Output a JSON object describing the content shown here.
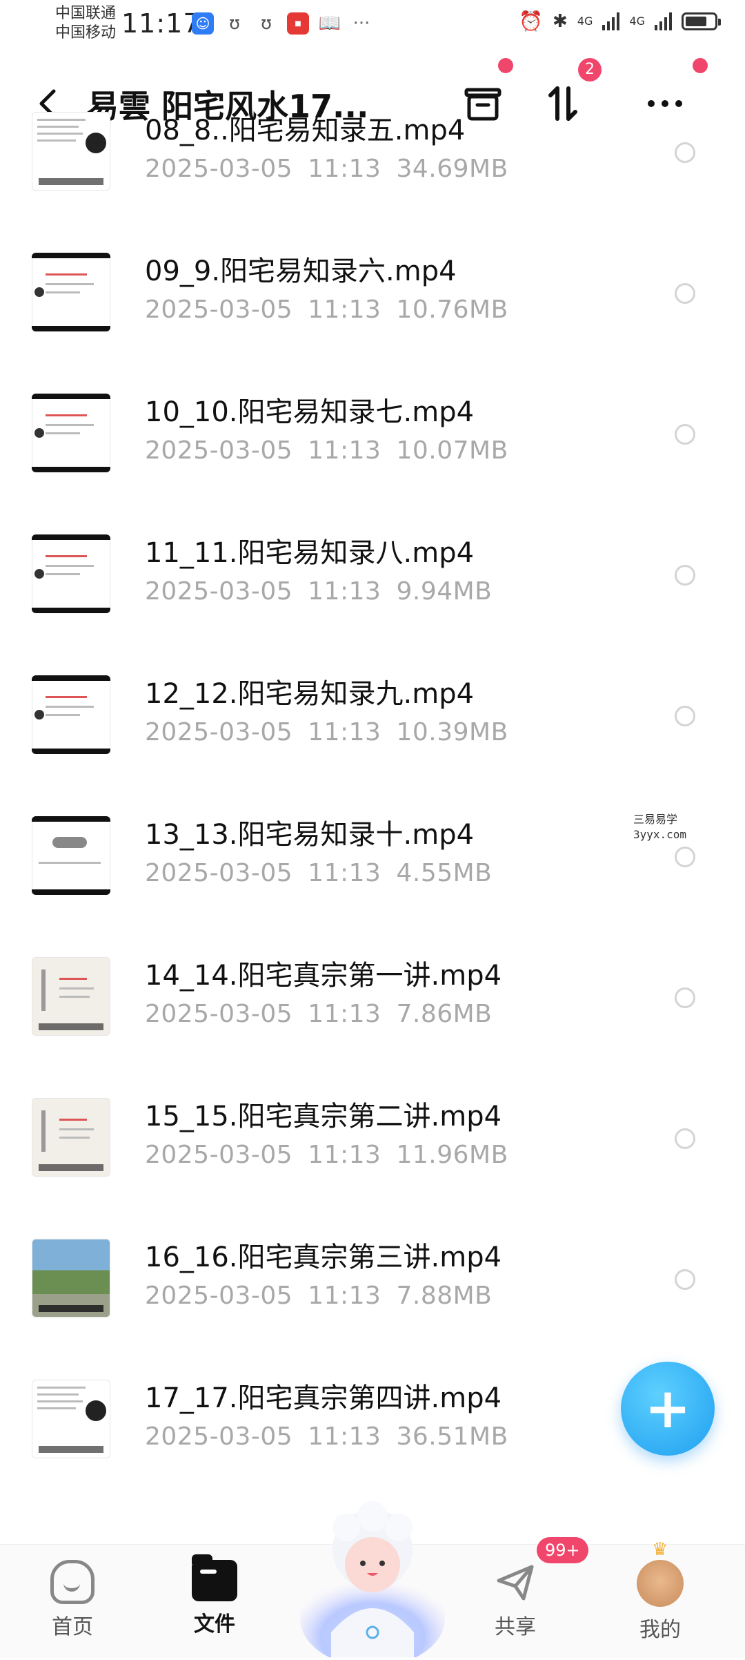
{
  "status_bar": {
    "carrier_1": "中国联通",
    "carrier_2": "中国移动",
    "time": "11:17",
    "network_1": "4G",
    "network_2": "4G",
    "battery_level": 0.75
  },
  "header": {
    "title": "易雲 阳宅风水17...",
    "transfer_badge": "2",
    "icons": [
      "back-arrow-icon",
      "archive-icon",
      "sort-transfer-icon",
      "more-icon"
    ]
  },
  "files": [
    {
      "name": "08_8..阳宅易知录五.mp4",
      "date": "2025-03-05",
      "time": "11:13",
      "size": "34.69MB"
    },
    {
      "name": "09_9.阳宅易知录六.mp4",
      "date": "2025-03-05",
      "time": "11:13",
      "size": "10.76MB"
    },
    {
      "name": "10_10.阳宅易知录七.mp4",
      "date": "2025-03-05",
      "time": "11:13",
      "size": "10.07MB"
    },
    {
      "name": "11_11.阳宅易知录八.mp4",
      "date": "2025-03-05",
      "time": "11:13",
      "size": "9.94MB"
    },
    {
      "name": "12_12.阳宅易知录九.mp4",
      "date": "2025-03-05",
      "time": "11:13",
      "size": "10.39MB"
    },
    {
      "name": "13_13.阳宅易知录十.mp4",
      "date": "2025-03-05",
      "time": "11:13",
      "size": "4.55MB"
    },
    {
      "name": "14_14.阳宅真宗第一讲.mp4",
      "date": "2025-03-05",
      "time": "11:13",
      "size": "7.86MB"
    },
    {
      "name": "15_15.阳宅真宗第二讲.mp4",
      "date": "2025-03-05",
      "time": "11:13",
      "size": "11.96MB"
    },
    {
      "name": "16_16.阳宅真宗第三讲.mp4",
      "date": "2025-03-05",
      "time": "11:13",
      "size": "7.88MB"
    },
    {
      "name": "17_17.阳宅真宗第四讲.mp4",
      "date": "2025-03-05",
      "time": "11:13",
      "size": "36.51MB"
    }
  ],
  "watermark": {
    "line1": "三易易学",
    "line2": "3yyx.com"
  },
  "fab": {
    "label": "+"
  },
  "bottom_nav": {
    "home": "首页",
    "files": "文件",
    "share": "共享",
    "share_badge": "99+",
    "mine": "我的"
  },
  "colors": {
    "accent_red": "#f0466b",
    "fab_blue": "#1f9ff0",
    "meta_gray": "#a8a8a8"
  }
}
